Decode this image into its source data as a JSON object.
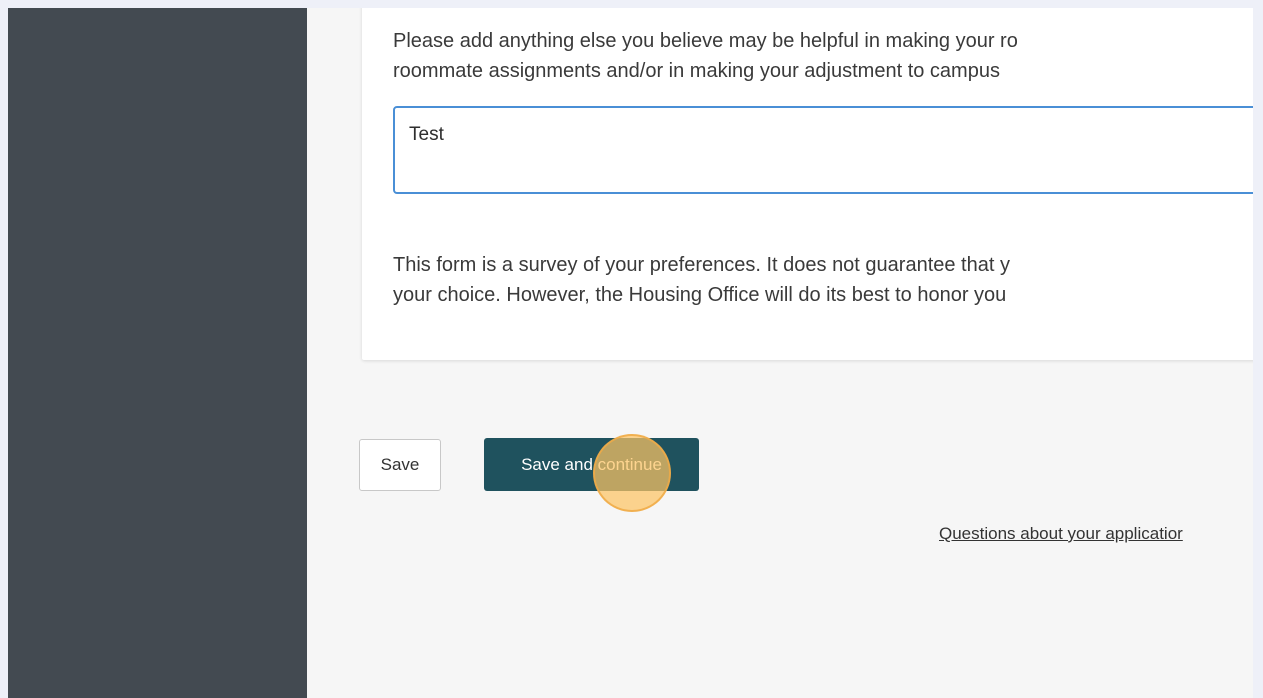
{
  "form": {
    "prompt_lines": [
      "Please add anything else you believe may be helpful in making your ro",
      "roommate assignments and/or in making your adjustment to campus"
    ],
    "textarea_value": "Test",
    "notice_lines": [
      "This form is a survey of your preferences. It does not guarantee that y",
      "your choice. However, the Housing Office will do its best to honor you"
    ]
  },
  "actions": {
    "save_label": "Save",
    "save_continue_label": "Save and continue"
  },
  "footer": {
    "help_link": "Questions about your applicatior"
  },
  "colors": {
    "sidebar": "#434a51",
    "primary_button": "#1f525e",
    "textarea_focus": "#4a8fd6",
    "click_marker": "#fcc464"
  }
}
